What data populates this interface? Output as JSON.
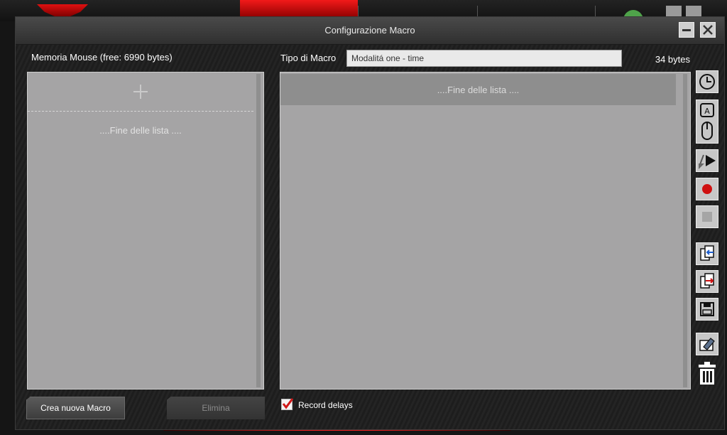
{
  "dialog": {
    "title": "Configurazione Macro",
    "memory_label": "Memoria Mouse (free: 6990 bytes)",
    "macro_type_label": "Tipo di Macro",
    "macro_type_value": "Modalitá one - time",
    "bytes_label": "34 bytes"
  },
  "macro_list": {
    "end_text": "....Fine delle lista ...."
  },
  "event_list": {
    "end_text": "....Fine delle lista ...."
  },
  "toolbar": {
    "icons": [
      "clock-icon",
      "keyboard-mouse-icon",
      "play-icon",
      "record-icon",
      "stop-icon",
      "import-icon",
      "export-icon",
      "save-icon",
      "edit-icon",
      "trash-icon"
    ]
  },
  "buttons": {
    "create": "Crea nuova Macro",
    "delete": "Elimina"
  },
  "record_delays": {
    "label": "Record delays",
    "checked": true
  },
  "colors": {
    "accent_red": "#e01b1b",
    "panel_gray": "#a5a4a5"
  }
}
